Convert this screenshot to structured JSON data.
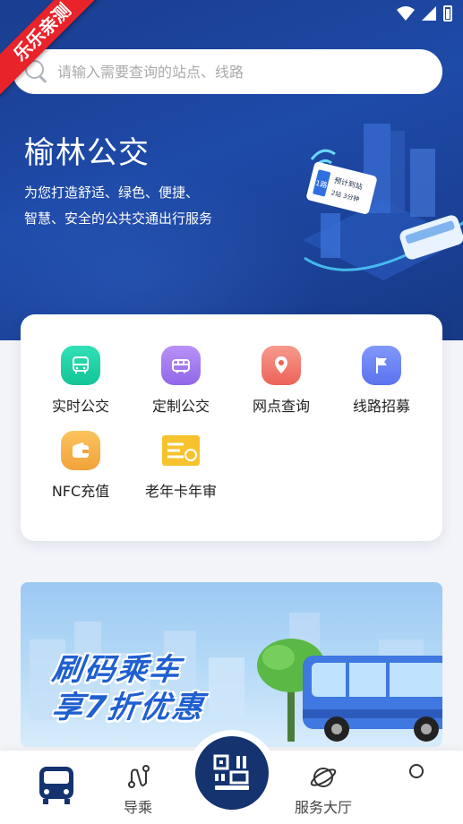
{
  "watermark": {
    "label": "乐乐亲测"
  },
  "status_bar": {
    "icons": [
      "wifi-icon",
      "signal-icon",
      "battery-icon"
    ]
  },
  "search": {
    "placeholder": "请输入需要查询的站点、线路"
  },
  "hero": {
    "title": "榆林公交",
    "subtitle_line1": "为您打造舒适、绿色、便捷、",
    "subtitle_line2": "智慧、安全的公共交通出行服务",
    "sign_title": "预计到站",
    "sign_detail": "2站 3分钟",
    "sign_badge": "1路"
  },
  "menu": {
    "items": [
      {
        "label": "实时公交",
        "icon": "bus-icon",
        "color": "#1ccfa5"
      },
      {
        "label": "定制公交",
        "icon": "custom-bus-icon",
        "color": "#a77cf0"
      },
      {
        "label": "网点查询",
        "icon": "location-icon",
        "color": "#f37b72"
      },
      {
        "label": "线路招募",
        "icon": "flag-icon",
        "color": "#6a82f5"
      },
      {
        "label": "NFC充值",
        "icon": "wallet-icon",
        "color": "#f7b44a"
      },
      {
        "label": "老年卡年审",
        "icon": "senior-card-icon",
        "color": "#f5c12e"
      }
    ]
  },
  "banner": {
    "line1": "刷码乘车",
    "line2": "享7折优惠"
  },
  "tabbar": {
    "items": [
      {
        "label": "",
        "icon": "bus-home-icon"
      },
      {
        "label": "导乘",
        "icon": "route-icon"
      },
      {
        "label": "",
        "icon": "qr-code-icon"
      },
      {
        "label": "服务大厅",
        "icon": "planet-icon"
      },
      {
        "label": "",
        "icon": "profile-icon"
      }
    ]
  },
  "colors": {
    "hero_bg": "#1e4aa8",
    "tab_active": "#14336f",
    "accent": "#1f5fd0"
  }
}
